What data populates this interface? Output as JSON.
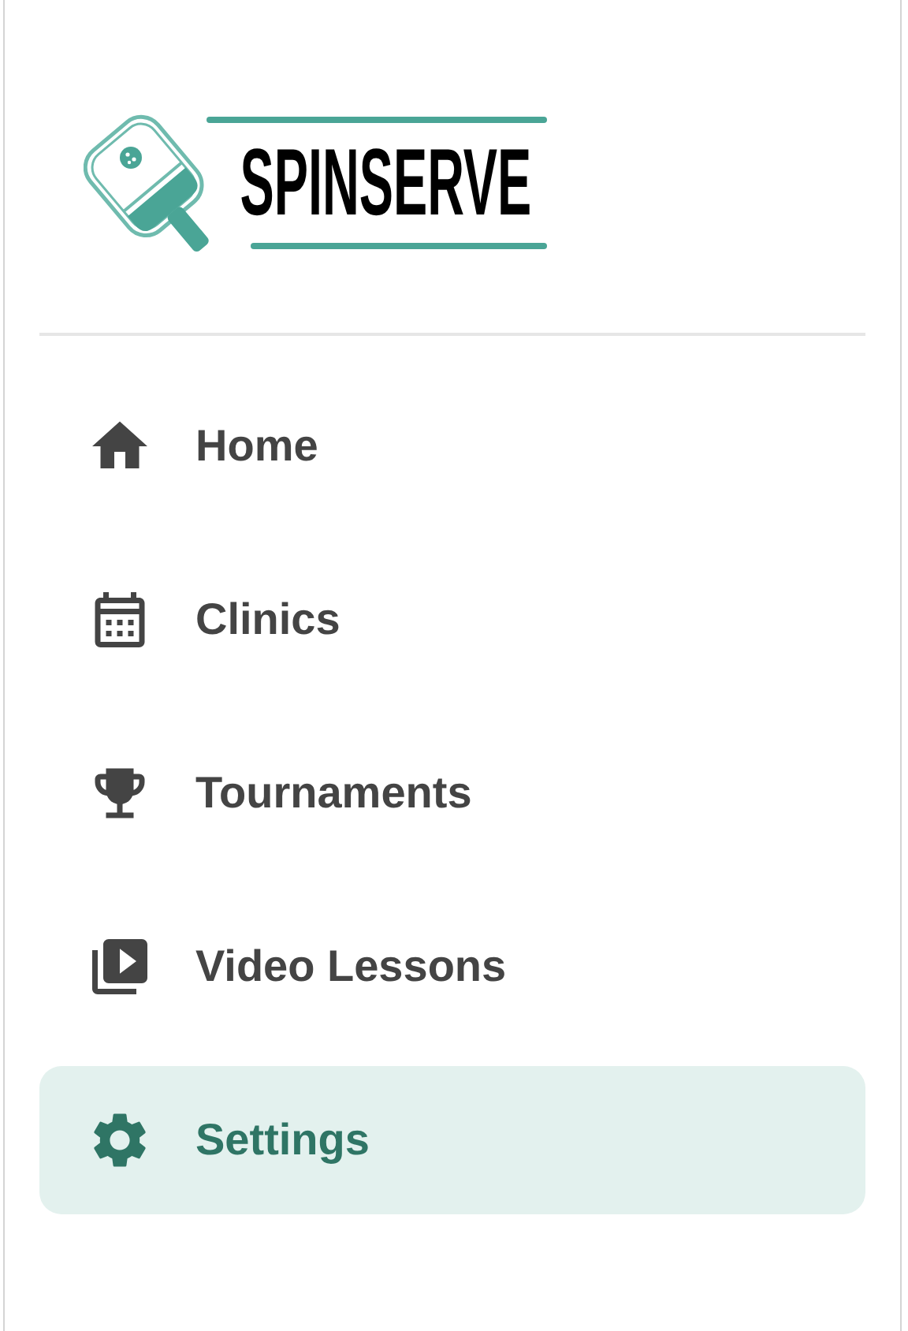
{
  "logo": {
    "text": "SPINSERVE"
  },
  "nav": [
    {
      "label": "Home",
      "selected": false
    },
    {
      "label": "Clinics",
      "selected": false
    },
    {
      "label": "Tournaments",
      "selected": false
    },
    {
      "label": "Video Lessons",
      "selected": false
    },
    {
      "label": "Settings",
      "selected": true
    }
  ]
}
